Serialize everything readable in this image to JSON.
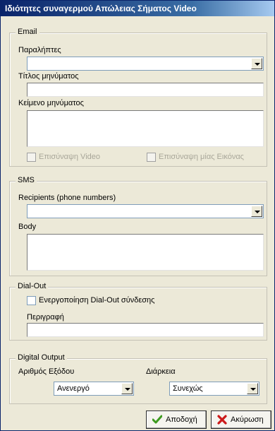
{
  "window": {
    "title": "Ιδιότητες συναγερμού Απώλειας Σήματος Video"
  },
  "email": {
    "legend": "Email",
    "recipients_label": "Παραλήπτες",
    "recipients_value": "",
    "subject_label": "Τίτλος μηνύματος",
    "subject_value": "",
    "body_label": "Κείμενο μηνύματος",
    "body_value": "",
    "attach_video_label": "Επισύναψη Video",
    "attach_video_checked": false,
    "attach_image_label": "Επισύναψη μίας Εικόνας",
    "attach_image_checked": false
  },
  "sms": {
    "legend": "SMS",
    "recipients_label": "Recipients (phone numbers)",
    "recipients_value": "",
    "body_label": "Body",
    "body_value": ""
  },
  "dialout": {
    "legend": "Dial-Out",
    "enable_label": "Ενεργοποίηση Dial-Out σύνδεσης",
    "enable_checked": false,
    "description_label": "Περιγραφή",
    "description_value": ""
  },
  "digital_output": {
    "legend": "Digital Output",
    "output_number_label": "Αριθμός Εξόδου",
    "output_number_value": "Ανενεργό",
    "duration_label": "Διάρκεια",
    "duration_value": "Συνεχώς"
  },
  "buttons": {
    "accept_label": "Αποδοχή",
    "cancel_label": "Ακύρωση"
  },
  "colors": {
    "title_bar": "#0a246a",
    "accept_icon": "#3d9a1f",
    "cancel_icon": "#cc1a1a"
  }
}
